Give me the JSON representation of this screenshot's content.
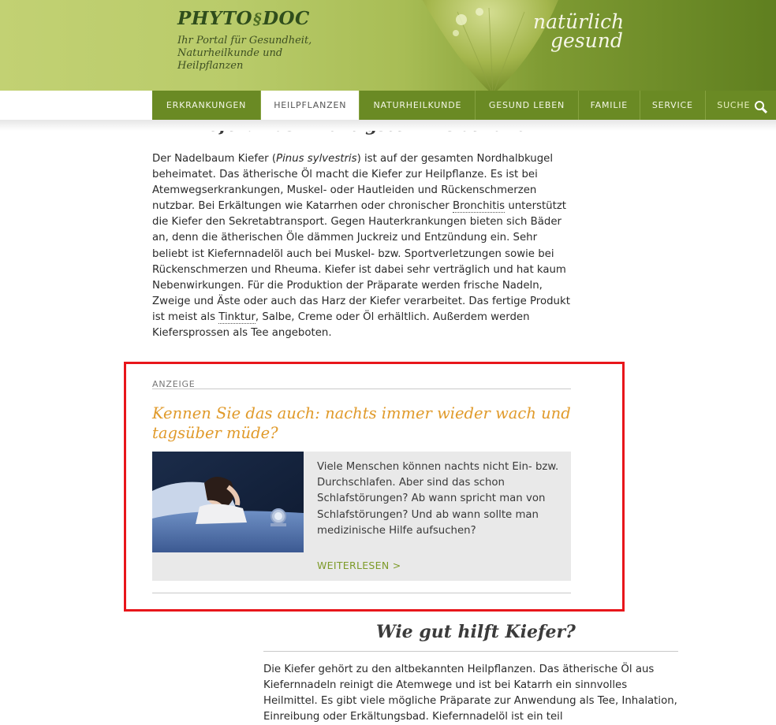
{
  "header": {
    "logo_text_1": "PHYTO",
    "logo_symbol": "§",
    "logo_text_2": "DOC",
    "tagline": "Ihr Portal für Gesundheit, Naturheilkunde und Heilpflanzen",
    "slogan_line1": "natürlich",
    "slogan_line2": "gesund"
  },
  "nav": {
    "items": [
      "ERKRANKUNGEN",
      "HEILPFLANZEN",
      "NATURHEILKUNDE",
      "GESUND LEBEN",
      "FAMILIE",
      "SERVICE",
      "SUCHE"
    ],
    "active": "HEILPFLANZEN"
  },
  "article": {
    "heading_cut": "Kiefer: Das Wichtigste im Überblick",
    "para1": {
      "a": "Der Nadelbaum Kiefer (",
      "latin": "Pinus sylvestris",
      "b": ") ist auf der gesamten Nordhalbkugel beheimatet. Das ätherische Öl macht die Kiefer zur Heilpflanze. Es ist bei Atemwegserkrankungen, Muskel- oder Hautleiden und Rückenschmerzen nutzbar. Bei Erkältungen wie Katarrhen oder chronischer ",
      "link1": "Bronchitis",
      "c": " unterstützt die Kiefer den Sekretabtransport. Gegen Hauterkrankungen bieten sich Bäder an, denn die ätherischen Öle dämmen Juckreiz und Entzündung ein. Sehr beliebt ist Kiefernnadelöl auch bei Muskel- bzw. Sportverletzungen sowie bei Rückenschmerzen und Rheuma. Kiefer ist dabei sehr verträglich und hat kaum Nebenwirkungen. Für die Produktion der Präparate werden frische Nadeln, Zweige und Äste oder auch das Harz der Kiefer verarbeitet. Das fertige Produkt ist meist als ",
      "link2": "Tinktur",
      "d": ", Salbe, Creme oder Öl erhältlich. Außerdem werden Kiefersprossen als Tee angeboten."
    },
    "heading2": "Wie gut hilft Kiefer?",
    "para2": "Die Kiefer gehört zu den altbekannten Heilpflanzen. Das ätherische Öl aus Kiefernnadeln reinigt die Atemwege und ist bei Katarrh ein sinnvolles Heilmittel. Es gibt viele mögliche Präparate zur Anwendung als Tee, Inhalation, Einreibung oder Erkältungsbad. Kiefernnadelöl ist ein teil"
  },
  "ad": {
    "label": "ANZEIGE",
    "title": "Kennen Sie das auch: nachts immer wieder wach und tagsüber müde?",
    "text": "Viele Menschen können nachts nicht Ein- bzw. Durchschlafen. Aber sind das schon Schlafstörungen? Ab wann spricht man von Schlafstörungen? Und ab wann sollte man medizinische Hilfe aufsuchen?",
    "more": "WEITERLESEN >"
  },
  "colors": {
    "accent_orange": "#e09a2a",
    "nav_green": "#6a8a24",
    "link_green": "#7d9a28",
    "highlight_red": "#e8161b"
  }
}
